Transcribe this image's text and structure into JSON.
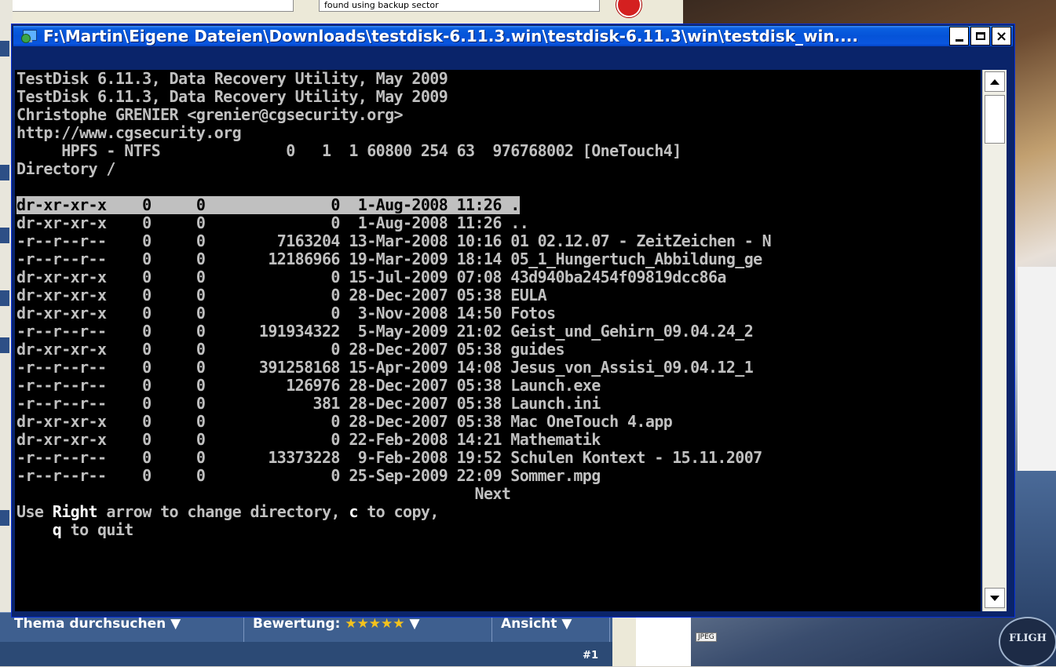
{
  "background": {
    "tab1_text": "",
    "tab2_text": "found using backup sector",
    "forum_buttons": [
      {
        "label": "Thema durchsuchen ▼"
      },
      {
        "label": "Bewertung:"
      },
      {
        "label": "Ansicht ▼"
      }
    ],
    "rating_stars": "★★★★★",
    "rating_arrow": " ▼",
    "post_number": "#1",
    "jpeg_label": "JPEG",
    "photo_logo_text": "FLIGH"
  },
  "window": {
    "title": "F:\\Martin\\Eigene Dateien\\Downloads\\testdisk-6.11.3.win\\testdisk-6.11.3\\win\\testdisk_win....",
    "minimize_label": "",
    "maximize_label": "",
    "close_label": "×"
  },
  "console": {
    "header_lines": [
      "TestDisk 6.11.3, Data Recovery Utility, May 2009",
      "TestDisk 6.11.3, Data Recovery Utility, May 2009",
      "Christophe GRENIER <grenier@cgsecurity.org>",
      "http://www.cgsecurity.org",
      "     HPFS - NTFS              0   1  1 60800 254 63  976768002 [OneTouch4]",
      "Directory /"
    ],
    "files": [
      {
        "perm": "dr-xr-xr-x",
        "uid": "0",
        "gid": "0",
        "size": "0",
        "date": "1-Aug-2008",
        "time": "11:26",
        "name": ".",
        "selected": true
      },
      {
        "perm": "dr-xr-xr-x",
        "uid": "0",
        "gid": "0",
        "size": "0",
        "date": "1-Aug-2008",
        "time": "11:26",
        "name": ".."
      },
      {
        "perm": "-r--r--r--",
        "uid": "0",
        "gid": "0",
        "size": "7163204",
        "date": "13-Mar-2008",
        "time": "10:16",
        "name": "01 02.12.07 - ZeitZeichen - N"
      },
      {
        "perm": "-r--r--r--",
        "uid": "0",
        "gid": "0",
        "size": "12186966",
        "date": "19-Mar-2009",
        "time": "18:14",
        "name": "05_1_Hungertuch_Abbildung_ge"
      },
      {
        "perm": "dr-xr-xr-x",
        "uid": "0",
        "gid": "0",
        "size": "0",
        "date": "15-Jul-2009",
        "time": "07:08",
        "name": "43d940ba2454f09819dcc86a"
      },
      {
        "perm": "dr-xr-xr-x",
        "uid": "0",
        "gid": "0",
        "size": "0",
        "date": "28-Dec-2007",
        "time": "05:38",
        "name": "EULA"
      },
      {
        "perm": "dr-xr-xr-x",
        "uid": "0",
        "gid": "0",
        "size": "0",
        "date": "3-Nov-2008",
        "time": "14:50",
        "name": "Fotos"
      },
      {
        "perm": "-r--r--r--",
        "uid": "0",
        "gid": "0",
        "size": "191934322",
        "date": "5-May-2009",
        "time": "21:02",
        "name": "Geist_und_Gehirn_09.04.24_2"
      },
      {
        "perm": "dr-xr-xr-x",
        "uid": "0",
        "gid": "0",
        "size": "0",
        "date": "28-Dec-2007",
        "time": "05:38",
        "name": "guides"
      },
      {
        "perm": "-r--r--r--",
        "uid": "0",
        "gid": "0",
        "size": "391258168",
        "date": "15-Apr-2009",
        "time": "14:08",
        "name": "Jesus_von_Assisi_09.04.12_1"
      },
      {
        "perm": "-r--r--r--",
        "uid": "0",
        "gid": "0",
        "size": "126976",
        "date": "28-Dec-2007",
        "time": "05:38",
        "name": "Launch.exe"
      },
      {
        "perm": "-r--r--r--",
        "uid": "0",
        "gid": "0",
        "size": "381",
        "date": "28-Dec-2007",
        "time": "05:38",
        "name": "Launch.ini"
      },
      {
        "perm": "dr-xr-xr-x",
        "uid": "0",
        "gid": "0",
        "size": "0",
        "date": "28-Dec-2007",
        "time": "05:38",
        "name": "Mac OneTouch 4.app"
      },
      {
        "perm": "dr-xr-xr-x",
        "uid": "0",
        "gid": "0",
        "size": "0",
        "date": "22-Feb-2008",
        "time": "14:21",
        "name": "Mathematik"
      },
      {
        "perm": "-r--r--r--",
        "uid": "0",
        "gid": "0",
        "size": "13373228",
        "date": "9-Feb-2008",
        "time": "19:52",
        "name": "Schulen Kontext - 15.11.2007"
      },
      {
        "perm": "-r--r--r--",
        "uid": "0",
        "gid": "0",
        "size": "0",
        "date": "25-Sep-2009",
        "time": "22:09",
        "name": "Sommer.mpg"
      }
    ],
    "next_label": "Next",
    "help": {
      "use": "Use ",
      "right": "Right",
      "mid": " arrow to change directory, ",
      "c": "c",
      "copy": " to copy,",
      "q": "q",
      "quit": " to quit"
    }
  },
  "colors": {
    "titlebar": "#0553d8",
    "console_bg": "#000000",
    "console_fg": "#c0c0c0",
    "highlight_bg": "#c0c0c0"
  }
}
